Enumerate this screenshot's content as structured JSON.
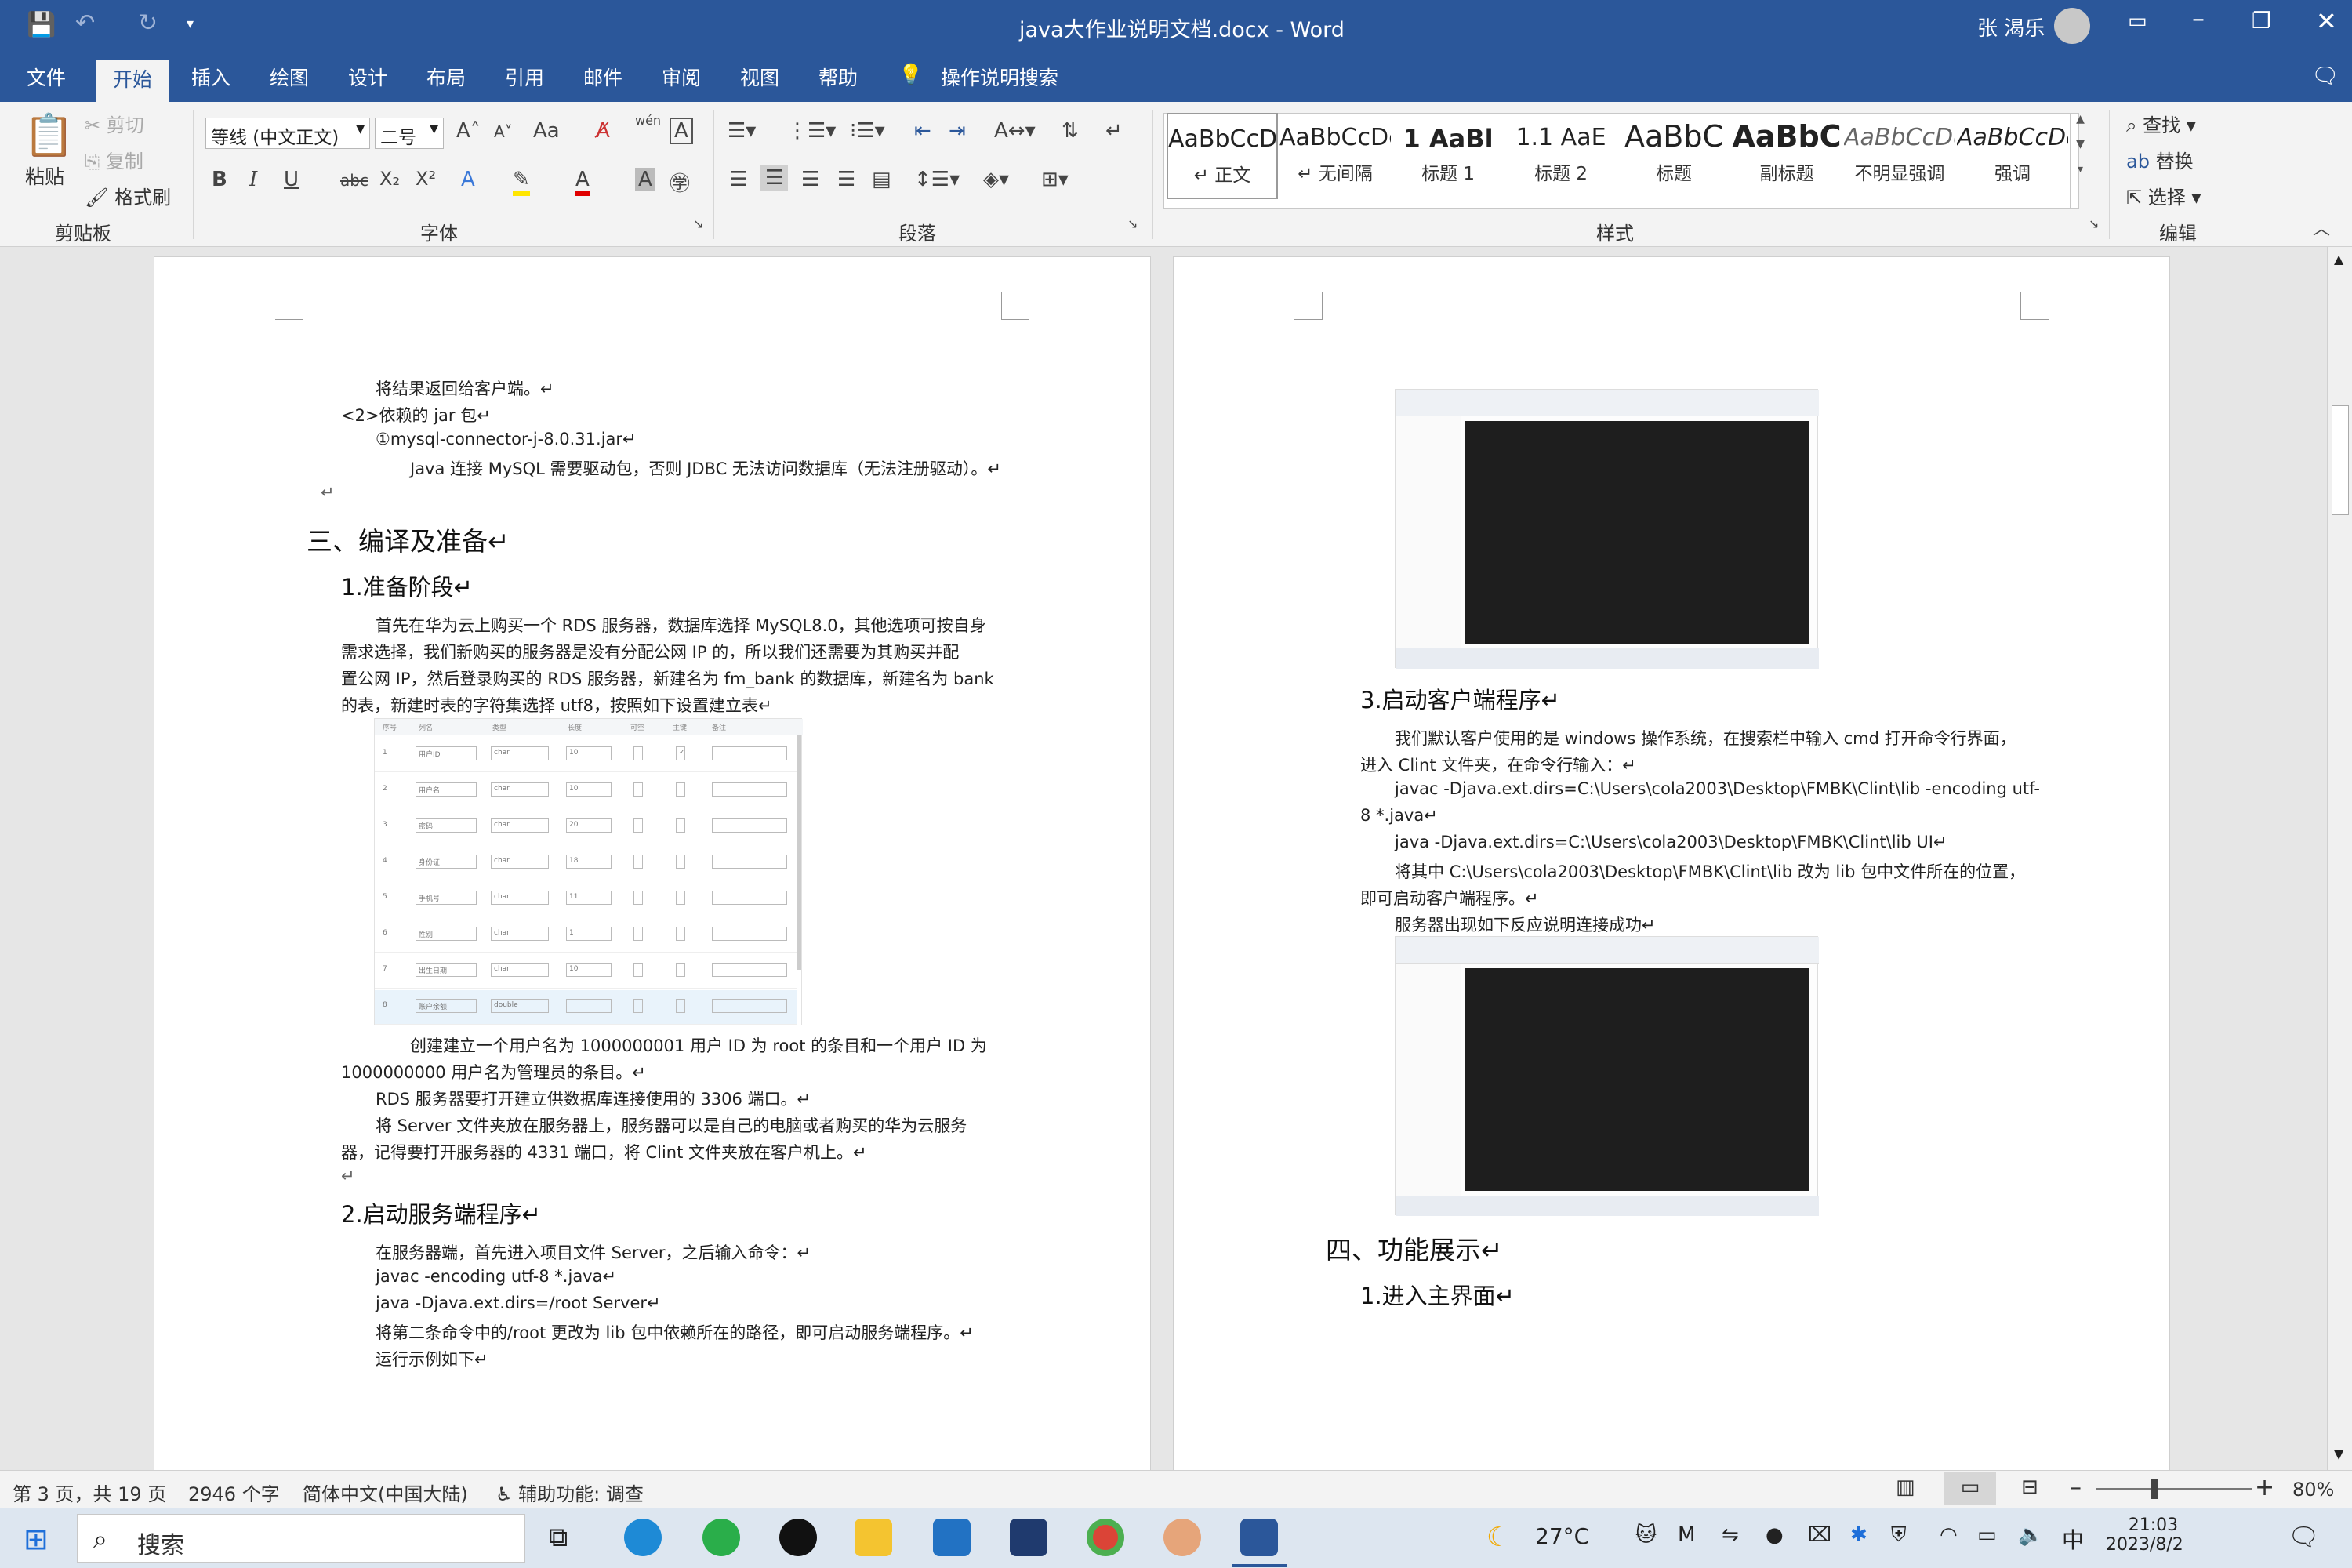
{
  "app": {
    "title": "java大作业说明文档.docx - Word",
    "user": "张 渴乐",
    "qat_more": "▾"
  },
  "tabs": [
    "文件",
    "开始",
    "插入",
    "绘图",
    "设计",
    "布局",
    "引用",
    "邮件",
    "审阅",
    "视图",
    "帮助",
    "操作说明搜索"
  ],
  "ribbon": {
    "clipboard": {
      "paste": "粘贴",
      "cut": "剪切",
      "copy": "复制",
      "format_painter": "格式刷",
      "label": "剪贴板"
    },
    "font": {
      "font_name": "等线 (中文正文)",
      "font_size": "二号",
      "label": "字体",
      "change_case": "Aa",
      "phonetic": "wén",
      "bold": "B",
      "italic": "I",
      "underline": "U",
      "strike": "abc",
      "sub": "X₂",
      "sup": "X²"
    },
    "paragraph": {
      "label": "段落"
    },
    "styles": {
      "label": "样式",
      "items": [
        {
          "sample": "AaBbCcDc",
          "name": "↵ 正文"
        },
        {
          "sample": "AaBbCcDc",
          "name": "↵ 无间隔"
        },
        {
          "sample": "1  AaBl",
          "name": "标题 1"
        },
        {
          "sample": "1.1  AaE",
          "name": "标题 2"
        },
        {
          "sample": "AaBbC",
          "name": "标题"
        },
        {
          "sample": "AaBbC",
          "name": "副标题"
        },
        {
          "sample": "AaBbCcDc",
          "name": "不明显强调"
        },
        {
          "sample": "AaBbCcDc",
          "name": "强调"
        }
      ]
    },
    "editing": {
      "find": "查找",
      "replace": "替换",
      "select": "选择",
      "label": "编辑"
    }
  },
  "page_left": {
    "lines": [
      "将结果返回给客户端。↵",
      "<2>依赖的 jar 包↵",
      "①mysql-connector-j-8.0.31.jar↵",
      "Java  连接 MySQL 需要驱动包，否则 JDBC 无法访问数据库（无法注册驱动）。↵",
      "↵"
    ],
    "h1": "三、编译及准备↵",
    "h2a": "1.准备阶段↵",
    "para1": [
      "首先在华为云上购买一个 RDS 服务器，数据库选择 MySQL8.0，其他选项可按自身",
      "需求选择，我们新购买的服务器是没有分配公网 IP 的，所以我们还需要为其购买并配",
      "置公网 IP，然后登录购买的 RDS 服务器，新建名为 fm_bank 的数据库，新建名为 bank",
      "的表，新建时表的字符集选择 utf8，按照如下设置建立表↵"
    ],
    "table_rows": [
      {
        "no": "1",
        "name": "用户ID",
        "type": "char",
        "len": "10"
      },
      {
        "no": "2",
        "name": "用户名",
        "type": "char",
        "len": "10"
      },
      {
        "no": "3",
        "name": "密码",
        "type": "char",
        "len": "20"
      },
      {
        "no": "4",
        "name": "身份证",
        "type": "char",
        "len": "18"
      },
      {
        "no": "5",
        "name": "手机号",
        "type": "char",
        "len": "11"
      },
      {
        "no": "6",
        "name": "性别",
        "type": "char",
        "len": "1"
      },
      {
        "no": "7",
        "name": "出生日期",
        "type": "char",
        "len": "10"
      },
      {
        "no": "8",
        "name": "账户余额",
        "type": "double",
        "len": ""
      }
    ],
    "table_headers": [
      "序号",
      "列名",
      "类型",
      "长度",
      "可空",
      "主键",
      "备注"
    ],
    "para2": [
      "创建建立一个用户名为 1000000001 用户 ID 为 root 的条目和一个用户 ID 为",
      "1000000000 用户名为管理员的条目。↵",
      "RDS 服务器要打开建立供数据库连接使用的 3306 端口。↵",
      "将  Server  文件夹放在服务器上，服务器可以是自己的电脑或者购买的华为云服务",
      "器，记得要打开服务器的 4331 端口，将 Clint 文件夹放在客户机上。↵",
      "↵"
    ],
    "h2b": "2.启动服务端程序↵",
    "para3": [
      "在服务器端，首先进入项目文件 Server，之后输入命令：↵",
      "javac -encoding utf-8 *.java↵",
      "java -Djava.ext.dirs=/root Server↵",
      "将第二条命令中的/root 更改为 lib 包中依赖所在的路径，即可启动服务端程序。↵",
      "运行示例如下↵"
    ]
  },
  "page_right": {
    "h2c": "3.启动客户端程序↵",
    "para4": [
      "我们默认客户使用的是 windows 操作系统，在搜索栏中输入 cmd 打开命令行界面，",
      "进入 Clint 文件夹，在命令行输入：↵",
      "javac -Djava.ext.dirs=C:\\Users\\cola2003\\Desktop\\FMBK\\Clint\\lib -encoding utf-",
      "8 *.java↵",
      "java -Djava.ext.dirs=C:\\Users\\cola2003\\Desktop\\FMBK\\Clint\\lib UI↵",
      "将其中 C:\\Users\\cola2003\\Desktop\\FMBK\\Clint\\lib 改为 lib 包中文件所在的位置，",
      "即可启动客户端程序。↵",
      "服务器出现如下反应说明连接成功↵"
    ],
    "h1b": "四、功能展示↵",
    "h2d": "1.进入主界面↵"
  },
  "status": {
    "page": "第 3 页，共 19 页",
    "words": "2946 个字",
    "lang": "简体中文(中国大陆)",
    "accessibility": "辅助功能: 调查",
    "zoom": "80%"
  },
  "taskbar": {
    "search": "搜索",
    "weather": "27°C",
    "ime": "中",
    "time": "21:03",
    "date": "2023/8/2"
  },
  "colors": {
    "brand": "#2b579a",
    "ribbon": "#f3f3f3",
    "page": "#ffffff",
    "terminal": "#1e1e1e"
  }
}
